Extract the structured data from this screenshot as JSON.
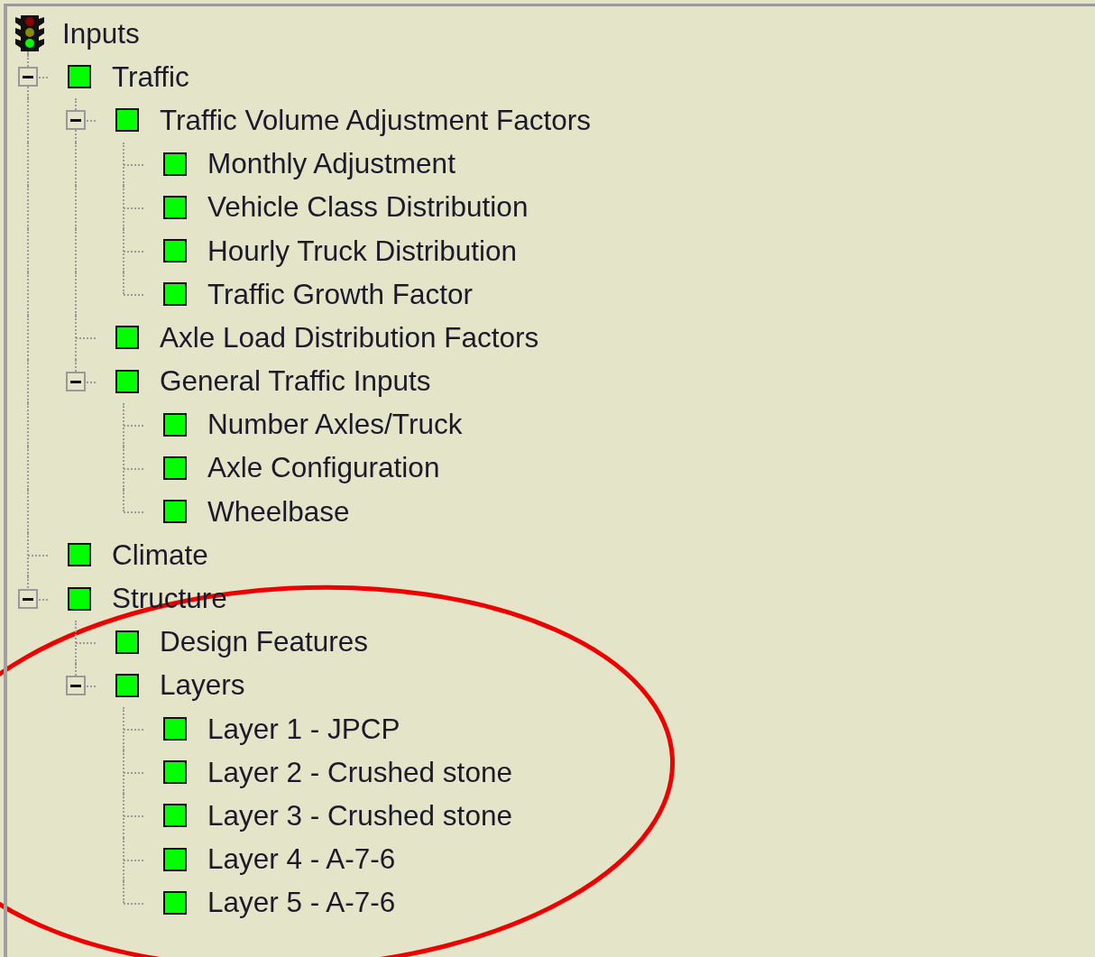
{
  "tree": {
    "label": "Inputs",
    "children": [
      {
        "label": "Traffic",
        "color": "#00ff00",
        "expanded": true,
        "children": [
          {
            "label": "Traffic Volume Adjustment Factors",
            "color": "#00ff00",
            "expanded": true,
            "children": [
              {
                "label": "Monthly Adjustment",
                "color": "#00ff00"
              },
              {
                "label": "Vehicle Class Distribution",
                "color": "#00ff00"
              },
              {
                "label": "Hourly Truck Distribution",
                "color": "#00ff00"
              },
              {
                "label": "Traffic Growth Factor",
                "color": "#00ff00"
              }
            ]
          },
          {
            "label": "Axle Load Distribution Factors",
            "color": "#00ff00"
          },
          {
            "label": "General Traffic Inputs",
            "color": "#00ff00",
            "expanded": true,
            "children": [
              {
                "label": "Number Axles/Truck",
                "color": "#00ff00"
              },
              {
                "label": "Axle Configuration",
                "color": "#00ff00"
              },
              {
                "label": "Wheelbase",
                "color": "#00ff00"
              }
            ]
          }
        ]
      },
      {
        "label": "Climate",
        "color": "#00ff00"
      },
      {
        "label": "Structure",
        "color": "#00ff00",
        "expanded": true,
        "children": [
          {
            "label": "Design Features",
            "color": "#00ff00"
          },
          {
            "label": "Layers",
            "color": "#00ff00",
            "expanded": true,
            "children": [
              {
                "label": "Layer 1 - JPCP",
                "color": "#00ff00"
              },
              {
                "label": "Layer 2 - Crushed stone",
                "color": "#00ff00"
              },
              {
                "label": "Layer 3 - Crushed stone",
                "color": "#00ff00"
              },
              {
                "label": "Layer 4 - A-7-6",
                "color": "#00ff00"
              },
              {
                "label": "Layer 5 - A-7-6",
                "color": "#00ff00"
              }
            ]
          }
        ]
      }
    ]
  }
}
